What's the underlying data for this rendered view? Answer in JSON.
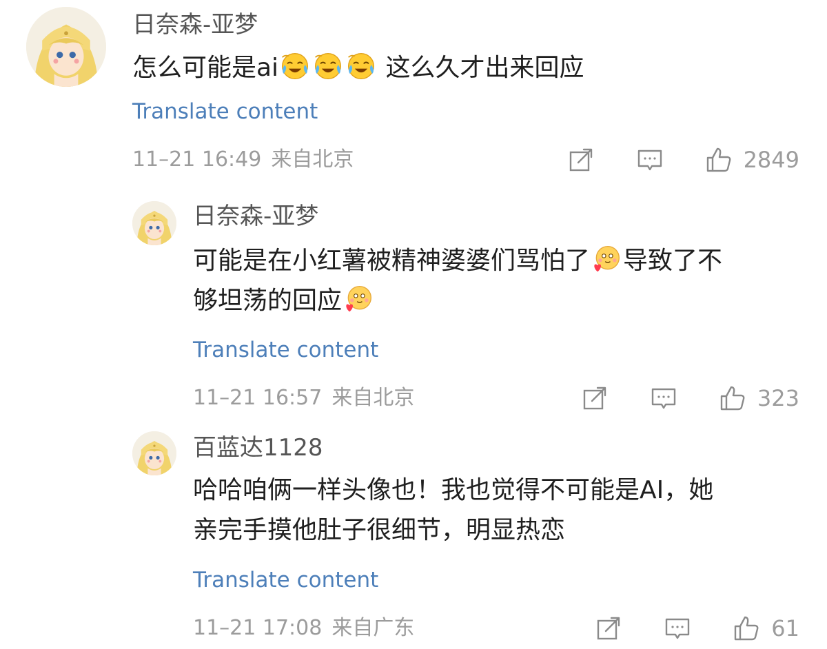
{
  "comments": [
    {
      "username": "日奈森-亚梦",
      "text_before": "怎么可能是ai",
      "text_after": " 这么久才出来回应",
      "translate_label": "Translate content",
      "time": "11–21 16:49",
      "location": "来自北京",
      "likes": "2849"
    },
    {
      "username": "日奈森-亚梦",
      "text_line1_before": "可能是在小红薯被精神婆婆们骂怕了",
      "text_line1_after": "导致了不",
      "text_line2_before": "够坦荡的回应",
      "translate_label": "Translate content",
      "time": "11–21 16:57",
      "location": "来自北京",
      "likes": "323"
    },
    {
      "username": "百蓝达1128",
      "text_line1": "哈哈咱俩一样头像也！我也觉得不可能是AI，她",
      "text_line2": "亲完手摸他肚子很细节，明显热恋",
      "translate_label": "Translate content",
      "time": "11–21 17:08",
      "location": "来自广东",
      "likes": "61"
    }
  ],
  "icons": {
    "share": "share-icon",
    "reply": "comment-icon",
    "like": "thumbs-up-icon",
    "emoji_cry": "laugh-cry-emoji",
    "emoji_heart": "heart-face-emoji"
  },
  "colors": {
    "translate_link": "#4d7fb9",
    "meta": "#9c9c9c",
    "username": "#555555"
  }
}
